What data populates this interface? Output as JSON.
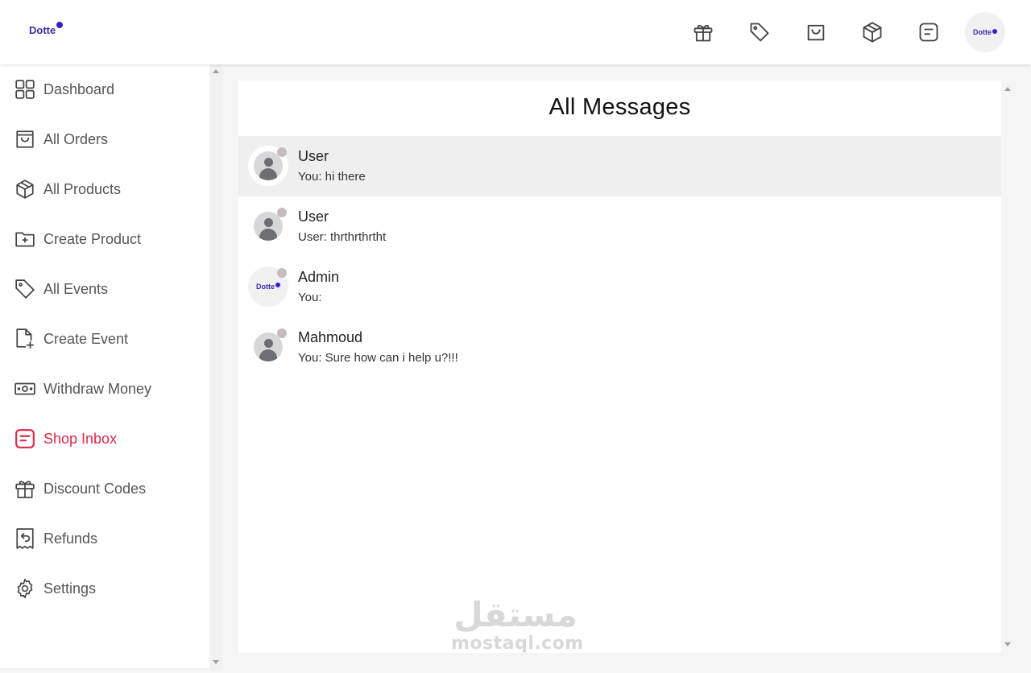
{
  "brand": {
    "logo_text": "Dotte",
    "accent": "#3321c8"
  },
  "header": {
    "icons": [
      "gift-icon",
      "tag-icon",
      "shopping-bag-icon",
      "package-icon",
      "message-icon"
    ]
  },
  "sidebar": {
    "active_color": "#e02a4a",
    "items": [
      {
        "label": "Dashboard",
        "icon": "grid-icon"
      },
      {
        "label": "All Orders",
        "icon": "shopping-bag-icon"
      },
      {
        "label": "All Products",
        "icon": "package-icon"
      },
      {
        "label": "Create Product",
        "icon": "folder-plus-icon"
      },
      {
        "label": "All Events",
        "icon": "tag-icon"
      },
      {
        "label": "Create Event",
        "icon": "file-plus-icon"
      },
      {
        "label": "Withdraw Money",
        "icon": "money-icon"
      },
      {
        "label": "Shop Inbox",
        "icon": "message-icon",
        "active": true
      },
      {
        "label": "Discount Codes",
        "icon": "gift-icon"
      },
      {
        "label": "Refunds",
        "icon": "receipt-refund-icon"
      },
      {
        "label": "Settings",
        "icon": "gear-icon"
      }
    ]
  },
  "main": {
    "title": "All Messages",
    "messages": [
      {
        "name": "User",
        "preview": "You: hi there",
        "active": true
      },
      {
        "name": "User",
        "preview": "User: thrthrthrtht"
      },
      {
        "name": "Admin",
        "preview": "You:",
        "brand_avatar": true
      },
      {
        "name": "Mahmoud",
        "preview": "You: Sure how can i help u?!!!"
      }
    ]
  },
  "watermark": {
    "arabic": "مستقل",
    "latin": "mostaql.com"
  }
}
